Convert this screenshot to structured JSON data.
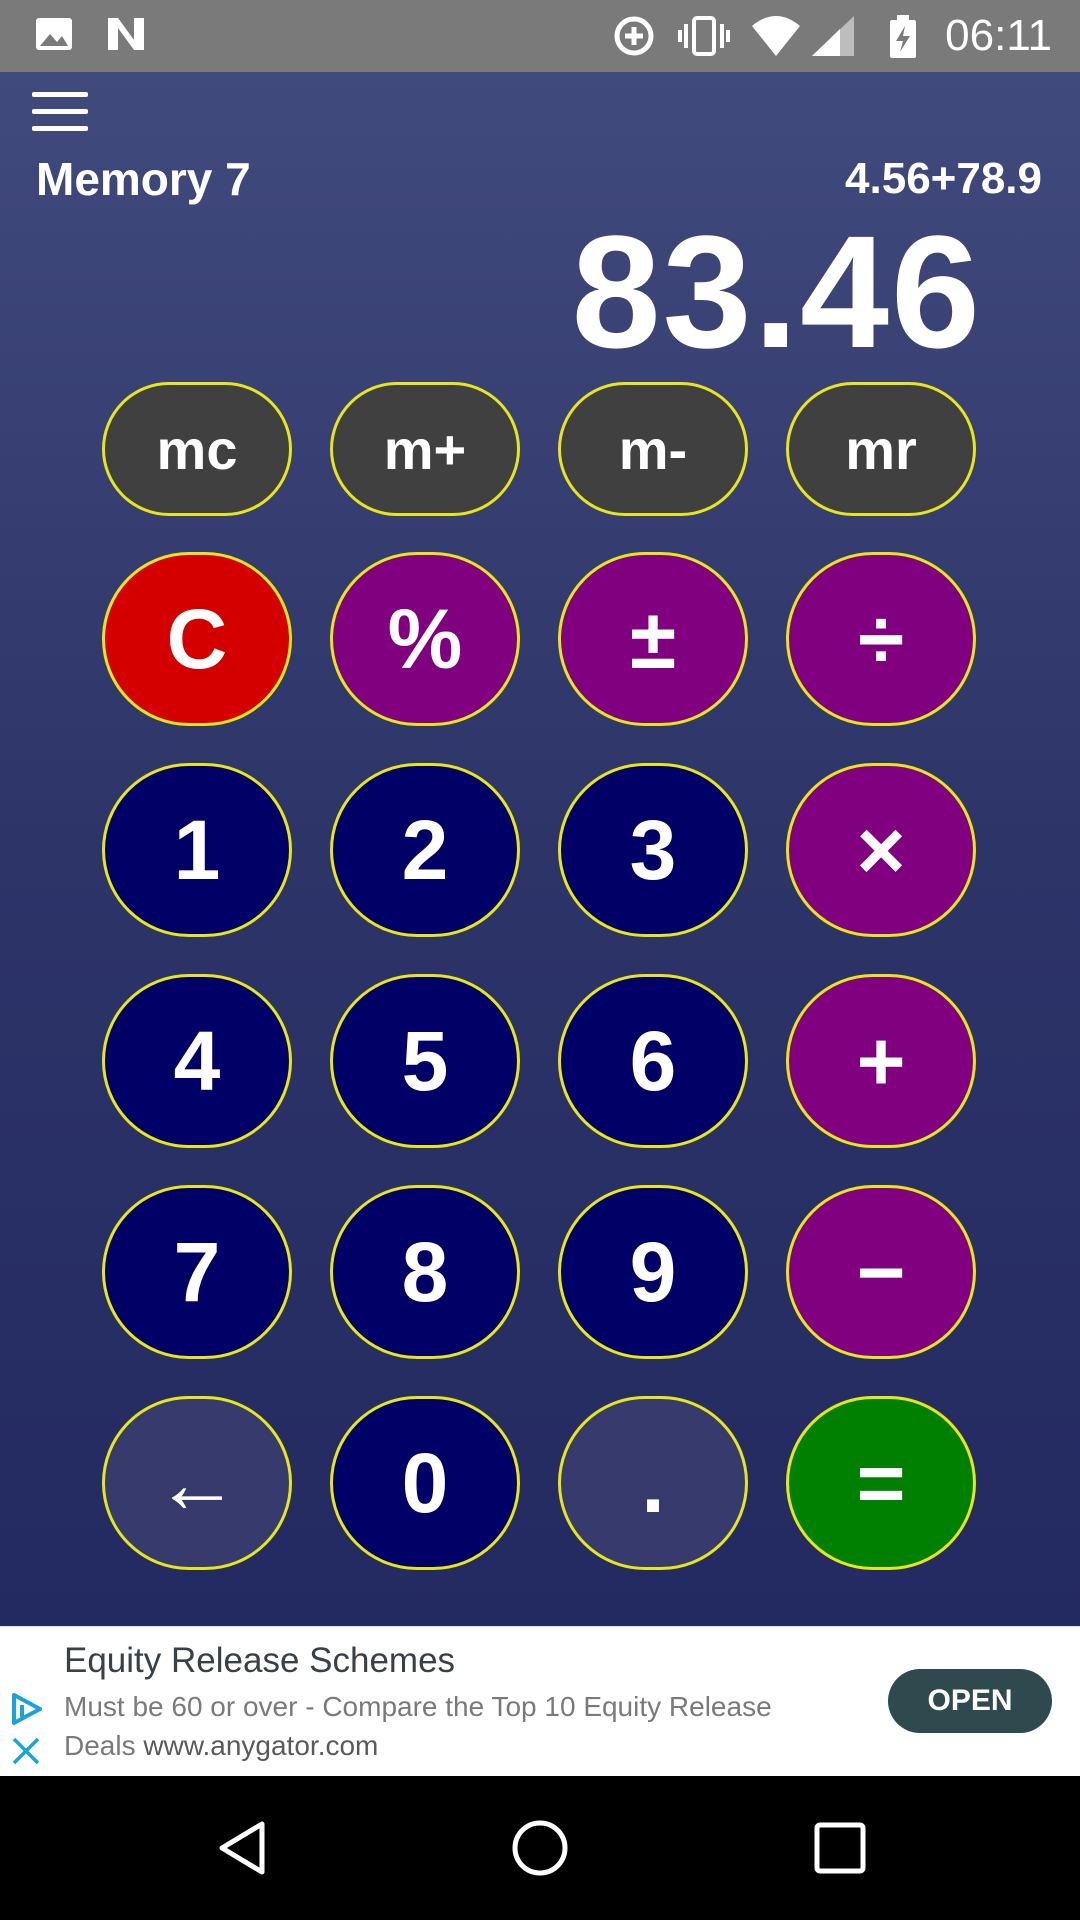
{
  "status_bar": {
    "time": "06:11",
    "icons": [
      "image-icon",
      "n-notification-icon",
      "data-saver-icon",
      "vibrate-icon",
      "wifi-icon",
      "signal-icon",
      "battery-charging-icon"
    ]
  },
  "calculator": {
    "memory_label": "Memory 7",
    "expression": "4.56+78.9",
    "result": "83.46",
    "memory_keys": [
      "mc",
      "m+",
      "m-",
      "mr"
    ],
    "keys": {
      "clear": "C",
      "percent": "%",
      "plus_minus": "±",
      "divide": "÷",
      "one": "1",
      "two": "2",
      "three": "3",
      "multiply": "×",
      "four": "4",
      "five": "5",
      "six": "6",
      "add": "+",
      "seven": "7",
      "eight": "8",
      "nine": "9",
      "subtract": "−",
      "backspace": "←",
      "zero": "0",
      "decimal": ".",
      "equals": "="
    }
  },
  "ad": {
    "title": "Equity Release Schemes",
    "description": "Must be 60 or over - Compare the Top 10 Equity Release Deals",
    "url": "www.anygator.com",
    "button": "OPEN"
  },
  "colors": {
    "background_top": "#414a7d",
    "background_bottom": "#232a61",
    "key_border": "#e6e619",
    "memory_key": "#404040",
    "clear_key": "#d40000",
    "operator_key": "#800080",
    "number_key": "#000066",
    "equals_key": "#008000"
  }
}
